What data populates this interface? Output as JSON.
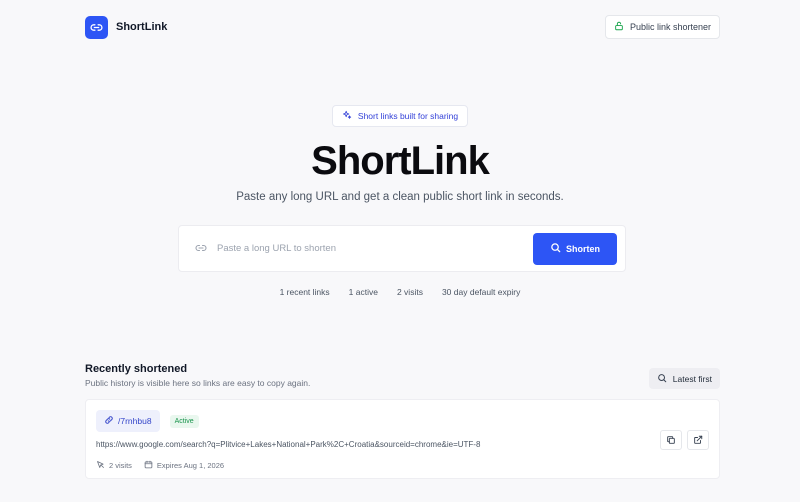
{
  "header": {
    "brand_name": "ShortLink",
    "badge_label": "Public link shortener"
  },
  "hero": {
    "pill_label": "Short links built for sharing",
    "title": "ShortLink",
    "subtitle": "Paste any long URL and get a clean public short link in seconds."
  },
  "shorten_form": {
    "url_value": "",
    "url_placeholder": "Paste a long URL to shorten",
    "button_label": "Shorten"
  },
  "stats": [
    "1 recent links",
    "1 active",
    "2 visits",
    "30 day default expiry"
  ],
  "recent": {
    "title": "Recently shortened",
    "subtitle": "Public history is visible here so links are easy to copy again.",
    "sort_label": "Latest first",
    "links": [
      {
        "slug": "/7rnhbu8",
        "status": "Active",
        "original_url": "https://www.google.com/search?q=Plitvice+Lakes+National+Park%2C+Croatia&sourceid=chrome&ie=UTF-8",
        "visits": "2 visits",
        "expires": "Expires Aug 1, 2026"
      }
    ]
  },
  "colors": {
    "accent": "#2d55f5",
    "active_green": "#17934a",
    "background": "#f8f8fa"
  }
}
